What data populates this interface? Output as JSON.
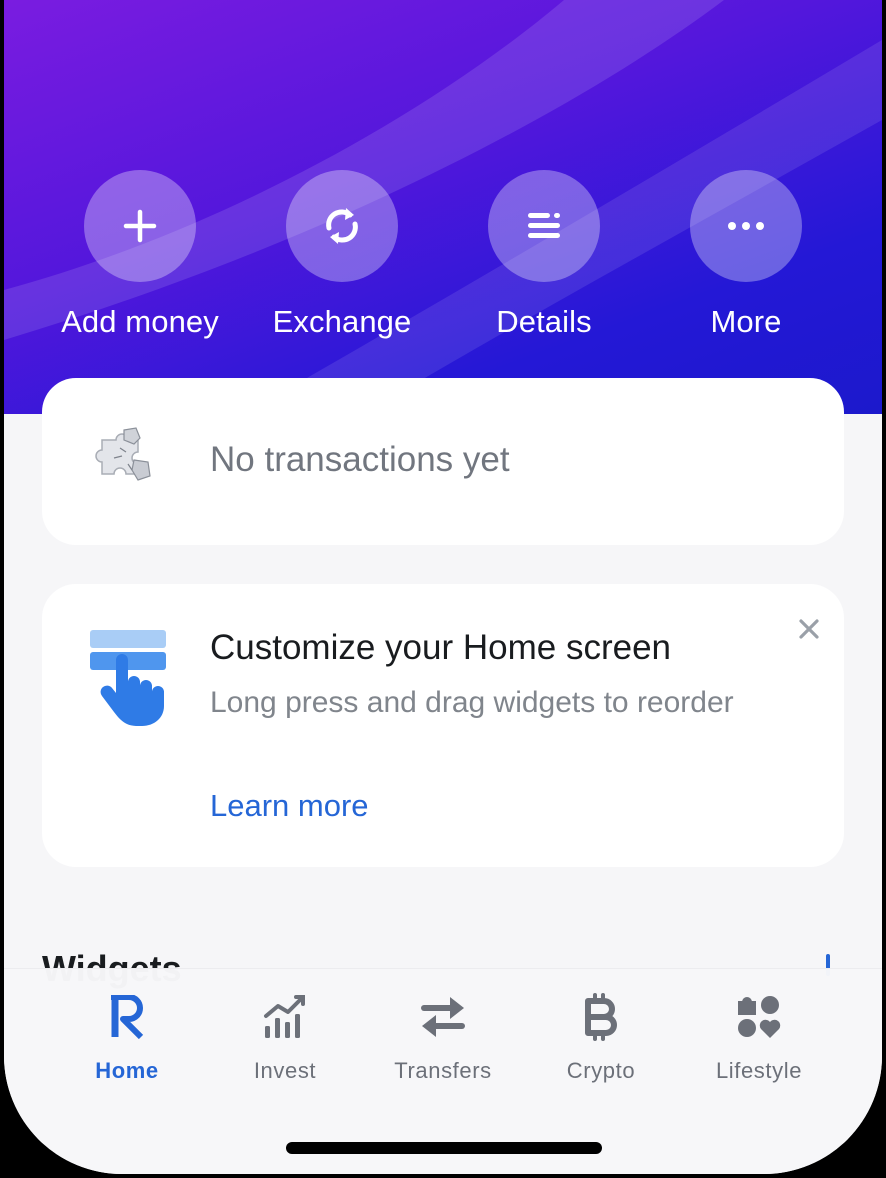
{
  "actions": [
    {
      "label": "Add money",
      "icon": "plus-icon"
    },
    {
      "label": "Exchange",
      "icon": "exchange-icon"
    },
    {
      "label": "Details",
      "icon": "details-icon"
    },
    {
      "label": "More",
      "icon": "more-icon"
    }
  ],
  "transactions": {
    "empty_text": "No transactions yet",
    "icon": "puzzle-icon"
  },
  "customize_card": {
    "title": "Customize your Home screen",
    "description": "Long press and drag widgets to reorder",
    "link": "Learn more",
    "icon": "drag-widget-icon"
  },
  "widgets": {
    "heading": "Widgets"
  },
  "tabbar": {
    "active": "Home",
    "items": [
      {
        "label": "Home",
        "icon": "revolut-r-icon"
      },
      {
        "label": "Invest",
        "icon": "invest-chart-icon"
      },
      {
        "label": "Transfers",
        "icon": "transfers-icon"
      },
      {
        "label": "Crypto",
        "icon": "bitcoin-icon"
      },
      {
        "label": "Lifestyle",
        "icon": "lifestyle-icon"
      }
    ]
  },
  "colors": {
    "accent": "#2566d6",
    "hero_start": "#7a1ce0",
    "hero_end": "#1c19cc",
    "background": "#f6f6f8"
  }
}
